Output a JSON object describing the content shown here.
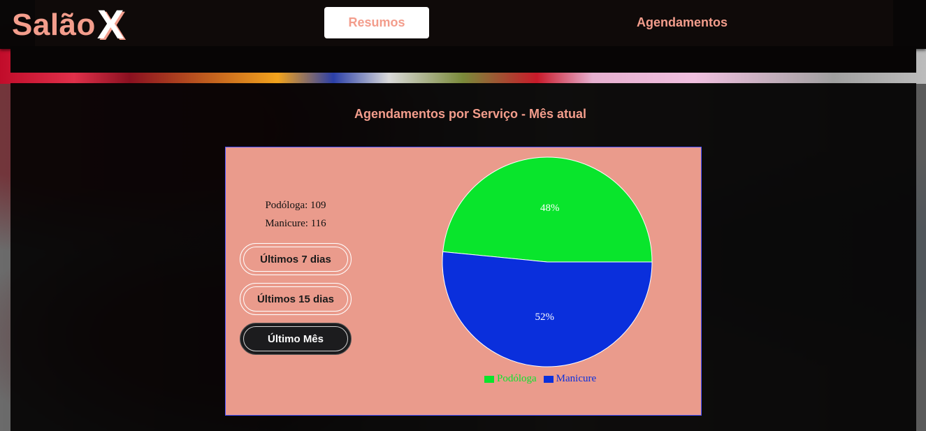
{
  "brand": {
    "name": "Salão",
    "mark": "X"
  },
  "nav": {
    "tabs": [
      {
        "label": "Resumos",
        "active": true
      },
      {
        "label": "Agendamentos",
        "active": false
      }
    ]
  },
  "card": {
    "title": "Agendamentos por Serviço - Mês atual"
  },
  "stats": [
    "Podóloga: 109",
    "Manicure: 116"
  ],
  "filters": [
    {
      "label": "Últimos 7 dias",
      "active": false
    },
    {
      "label": "Últimos 15 dias",
      "active": false
    },
    {
      "label": "Último Mês",
      "active": true
    }
  ],
  "colors": {
    "accent": "#f39d8c",
    "podologa": "#09e52c",
    "manicure": "#0a2fdc"
  },
  "chart_data": {
    "type": "pie",
    "categories": [
      "Podóloga",
      "Manicure"
    ],
    "values": [
      109,
      116
    ],
    "percent_labels": [
      "48%",
      "52%"
    ],
    "colors": [
      "#09e52c",
      "#0a2fdc"
    ],
    "legend": "bottom"
  }
}
